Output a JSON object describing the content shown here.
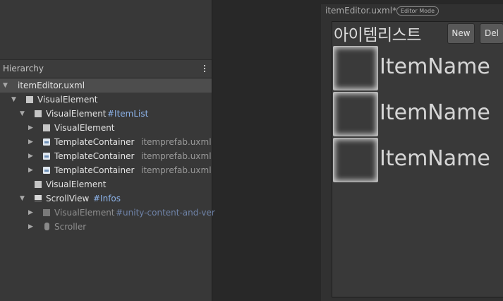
{
  "hierarchy": {
    "title": "Hierarchy",
    "rows": [
      {
        "label": "itemEditor.uxml"
      },
      {
        "label": "VisualElement"
      },
      {
        "label": "VisualElement",
        "cls": "#ItemList"
      },
      {
        "label": "VisualElement"
      },
      {
        "label": "TemplateContainer",
        "src": "itemprefab.uxml"
      },
      {
        "label": "TemplateContainer",
        "src": "itemprefab.uxml"
      },
      {
        "label": "TemplateContainer",
        "src": "itemprefab.uxml"
      },
      {
        "label": "VisualElement"
      },
      {
        "label": "ScrollView",
        "cls": "#Infos"
      },
      {
        "label": "VisualElement",
        "cls": "#unity-content-and-ver"
      },
      {
        "label": "Scroller"
      }
    ]
  },
  "canvas": {
    "title": "itemEditor.uxml*",
    "mode_badge": "Editor Mode",
    "doc_title": "아이템리스트",
    "new_label": "New",
    "del_label": "Del",
    "items": [
      {
        "name": "ItemName"
      },
      {
        "name": "ItemName"
      },
      {
        "name": "ItemName"
      }
    ]
  },
  "colors": {
    "class_name": "#8cb2e8",
    "selection": "#4d4d4d"
  }
}
